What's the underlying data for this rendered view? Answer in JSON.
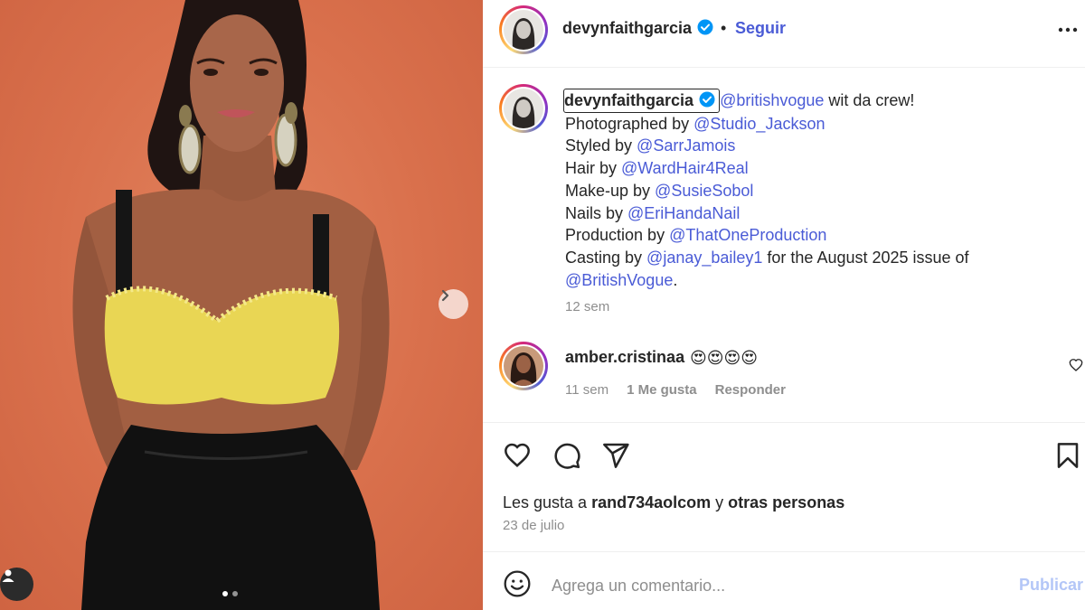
{
  "post": {
    "author": "devynfaithgarcia",
    "verified": true,
    "follow_label": "Seguir",
    "separator": "•",
    "caption": {
      "mention_main": "@britishvogue",
      "text_main": " wit da crew!",
      "lines": [
        {
          "prefix": "Photographed by ",
          "handle": "@Studio_Jackson"
        },
        {
          "prefix": "Styled by ",
          "handle": "@SarrJamois"
        },
        {
          "prefix": "Hair by ",
          "handle": "@WardHair4Real"
        },
        {
          "prefix": "Make-up by ",
          "handle": "@SusieSobol"
        },
        {
          "prefix": "Nails by ",
          "handle": "@EriHandaNail"
        },
        {
          "prefix": "Production by ",
          "handle": "@ThatOneProduction"
        }
      ],
      "casting_prefix": "Casting by ",
      "casting_handle": "@janay_bailey1",
      "casting_suffix": " for the August 2025 issue of",
      "final_handle": "@BritishVogue",
      "final_suffix": "."
    },
    "caption_time": "12 sem",
    "likes_prefix": "Les gusta a ",
    "likes_user": "rand734aolcom",
    "likes_middle": " y ",
    "likes_others": "otras personas",
    "date": "23 de julio"
  },
  "comment": {
    "user": "amber.cristinaa",
    "text": "😍😍😍😍",
    "time": "11 sem",
    "likes": "1 Me gusta",
    "reply_label": "Responder"
  },
  "add_comment": {
    "placeholder": "Agrega un comentario...",
    "publish_label": "Publicar"
  },
  "carousel": {
    "total_slides": 2,
    "current_slide": 1
  },
  "icons": {
    "more": "more-horizontal-icon",
    "verified": "verified-badge-icon",
    "like": "heart-icon",
    "comment": "comment-icon",
    "share": "share-icon",
    "save": "bookmark-icon",
    "emoji": "emoji-icon",
    "next": "chevron-right-icon",
    "tag": "user-tag-icon"
  },
  "colors": {
    "link": "#4a5bd6",
    "muted": "#8e8e8e",
    "verified": "#0095f6",
    "background_photo": "#d9704c"
  }
}
